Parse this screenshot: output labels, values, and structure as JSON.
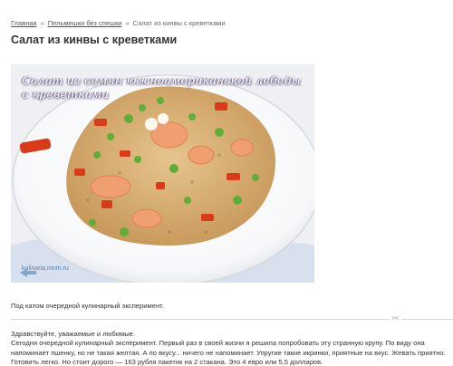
{
  "breadcrumb": {
    "items": [
      "Главная",
      "Пельмешки без спешки",
      "Салат из кинвы с креветками"
    ],
    "separator": "»"
  },
  "page_title": "Салат из кинвы с креветками",
  "photo": {
    "caption_line1": "Салат из семян южноамериканской лебеды",
    "caption_line2": "с креветками",
    "watermark": "kulinaria.mnm.ru"
  },
  "intro_text": "Под катом очередной кулинарный эксперимент.",
  "greeting": "Здравствуйте, уважаемые и любимые.",
  "body_text": "Сегодня очередной кулинарный эксперимент. Первый раз в своей жизни я решила попробовать эту странную крупу. По виду она напоминает пшенку, но не такая желтая. А по вкусу... ничего не напоминает. Упругие такие икринки, приятные на вкус. Жевать приятно. Готовить легко. Но стоит дорого — 163 рубля пакетик на 2 стакана. Это 4 евро или 5,5 долларов.",
  "colors": {
    "title": "#333333",
    "link": "#555555",
    "plate": "#ffffff",
    "quinoa": "#d8b478",
    "shrimp": "#f0a070",
    "pepper": "#d83a1a",
    "scallion": "#5fae3a"
  },
  "icons": {
    "divider": "scissors-icon",
    "watermark": "arrows-logo-icon"
  }
}
